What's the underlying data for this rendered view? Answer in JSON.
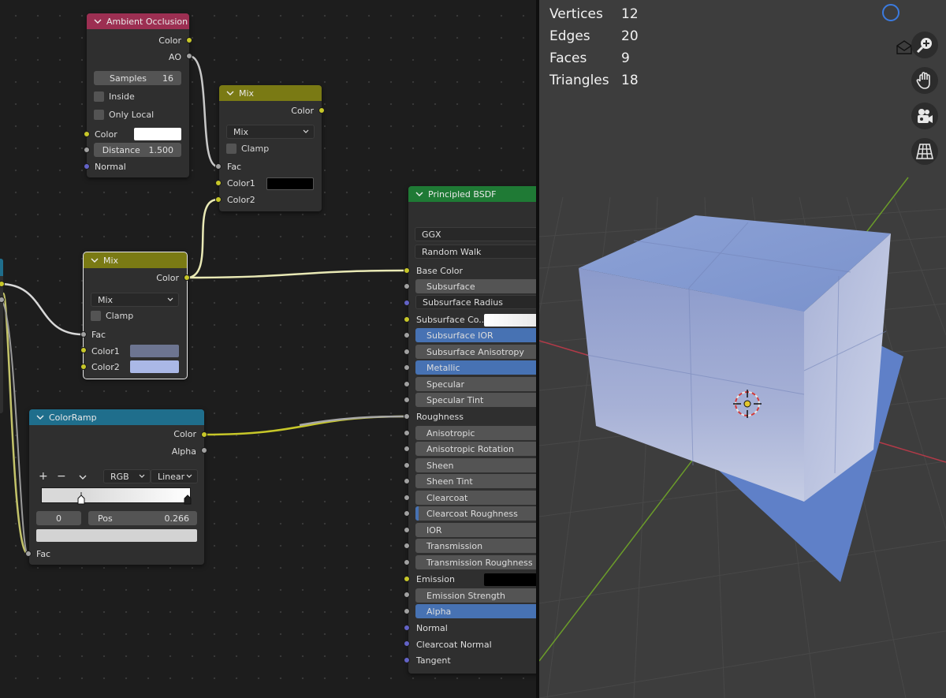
{
  "node_editor": {
    "ambient_occlusion": {
      "title": "Ambient Occlusion",
      "outputs": [
        "Color",
        "AO"
      ],
      "samples_label": "Samples",
      "samples_value": "16",
      "inside_label": "Inside",
      "only_local_label": "Only Local",
      "color_label": "Color",
      "distance_label": "Distance",
      "distance_value": "1.500",
      "normal_label": "Normal",
      "color_swatch": "#ffffff"
    },
    "mix_top": {
      "title": "Mix",
      "output": "Color",
      "blend_mode": "Mix",
      "clamp_label": "Clamp",
      "fac_label": "Fac",
      "color1_label": "Color1",
      "color2_label": "Color2",
      "color1_swatch": "#000000"
    },
    "mix_mid": {
      "title": "Mix",
      "output": "Color",
      "blend_mode": "Mix",
      "clamp_label": "Clamp",
      "fac_label": "Fac",
      "color1_label": "Color1",
      "color2_label": "Color2",
      "color1_swatch": "#6d7591",
      "color2_swatch": "#aab8e6"
    },
    "colorramp": {
      "title": "ColorRamp",
      "outputs": [
        "Color",
        "Alpha"
      ],
      "add_label": "+",
      "remove_label": "−",
      "color_mode": "RGB",
      "interpolation": "Linear",
      "index_value": "0",
      "pos_label": "Pos",
      "pos_value": "0.266",
      "fac_label": "Fac"
    },
    "principled": {
      "title": "Principled BSDF",
      "distribution": "GGX",
      "subsurface_method": "Random Walk",
      "base_color_label": "Base Color",
      "subsurface_label": "Subsurface",
      "subsurface_radius_label": "Subsurface Radius",
      "subsurface_color_label": "Subsurface Co...",
      "subsurface_ior_label": "Subsurface IOR",
      "subsurface_anisotropy_label": "Subsurface Anisotropy",
      "metallic_label": "Metallic",
      "specular_label": "Specular",
      "specular_tint_label": "Specular Tint",
      "roughness_label": "Roughness",
      "anisotropic_label": "Anisotropic",
      "anisotropic_rotation_label": "Anisotropic Rotation",
      "sheen_label": "Sheen",
      "sheen_tint_label": "Sheen Tint",
      "clearcoat_label": "Clearcoat",
      "clearcoat_roughness_label": "Clearcoat Roughness",
      "ior_label": "IOR",
      "transmission_label": "Transmission",
      "transmission_roughness_label": "Transmission Roughness",
      "emission_label": "Emission",
      "emission_strength_label": "Emission Strength",
      "alpha_label": "Alpha",
      "normal_label": "Normal",
      "clearcoat_normal_label": "Clearcoat Normal",
      "tangent_label": "Tangent"
    }
  },
  "viewport": {
    "stats": [
      {
        "label": "Vertices",
        "value": "12"
      },
      {
        "label": "Edges",
        "value": "20"
      },
      {
        "label": "Faces",
        "value": "9"
      },
      {
        "label": "Triangles",
        "value": "18"
      }
    ]
  },
  "colors": {
    "socket_color": "#c7c729",
    "socket_value": "#a1a1a1",
    "socket_vector": "#6363c7",
    "ao_header": "#9c2f52",
    "mix_header": "#7a7a14",
    "ramp_header": "#1f6e8c",
    "bsdf_header": "#1f7a35",
    "selected_field": "#4772b3"
  },
  "icons": [
    "chevron-down-icon",
    "zoom-icon",
    "hand-icon",
    "camera-icon",
    "grid-icon",
    "gizmo-circle-icon",
    "3d-cursor-icon"
  ]
}
